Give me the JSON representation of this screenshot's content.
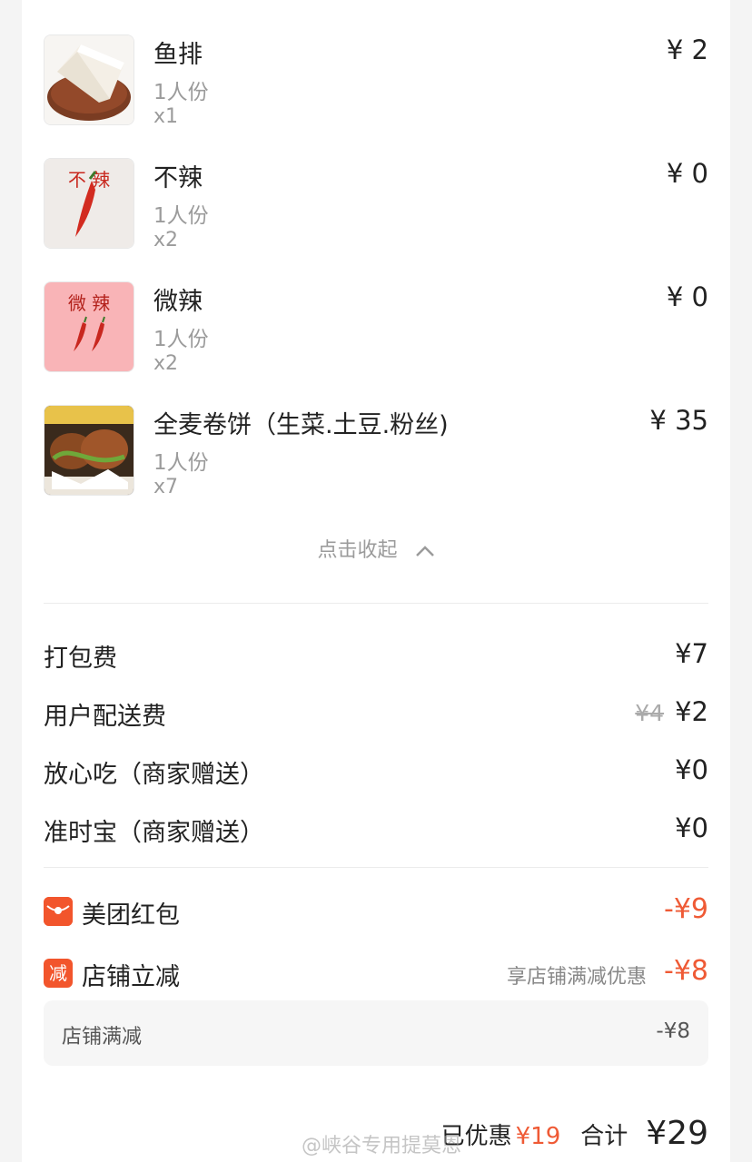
{
  "items": [
    {
      "name": "鱼排",
      "portion": "1人份",
      "qty": "x1",
      "price": "¥ 2",
      "icon": "fish-fillet-image"
    },
    {
      "name": "不辣",
      "portion": "1人份",
      "qty": "x2",
      "price": "¥ 0",
      "icon": "not-spicy-image",
      "image_text": "不  辣"
    },
    {
      "name": "微辣",
      "portion": "1人份",
      "qty": "x2",
      "price": "¥ 0",
      "icon": "mild-spicy-image",
      "image_text": "微  辣"
    },
    {
      "name": "全麦卷饼（生菜.土豆.粉丝)",
      "portion": "1人份",
      "qty": "x7",
      "price": "¥ 35",
      "icon": "wrap-image"
    }
  ],
  "collapse_label": "点击收起",
  "fees": [
    {
      "label": "打包费",
      "value": "¥7"
    },
    {
      "label": "用户配送费",
      "old_value": "¥4",
      "value": "¥2"
    },
    {
      "label": "放心吃（商家赠送）",
      "value": "¥0"
    },
    {
      "label": "准时宝（商家赠送）",
      "value": "¥0"
    }
  ],
  "discounts": [
    {
      "badge": "",
      "icon": "red-packet-icon",
      "label": "美团红包",
      "value": "-¥9"
    },
    {
      "badge": "减",
      "icon": "discount-badge-icon",
      "label": "店铺立减",
      "note": "享店铺满减优惠",
      "value": "-¥8"
    }
  ],
  "sub_discount": {
    "label": "店铺满减",
    "value": "-¥8"
  },
  "summary": {
    "saved_label": "已优惠",
    "saved_value": "¥19",
    "total_label": "合计",
    "total_value": "¥29"
  },
  "watermark": "@峡谷专用提莫恩",
  "colors": {
    "accent": "#ef5a35",
    "badge": "#f2552c",
    "muted": "#9b9b9b"
  }
}
